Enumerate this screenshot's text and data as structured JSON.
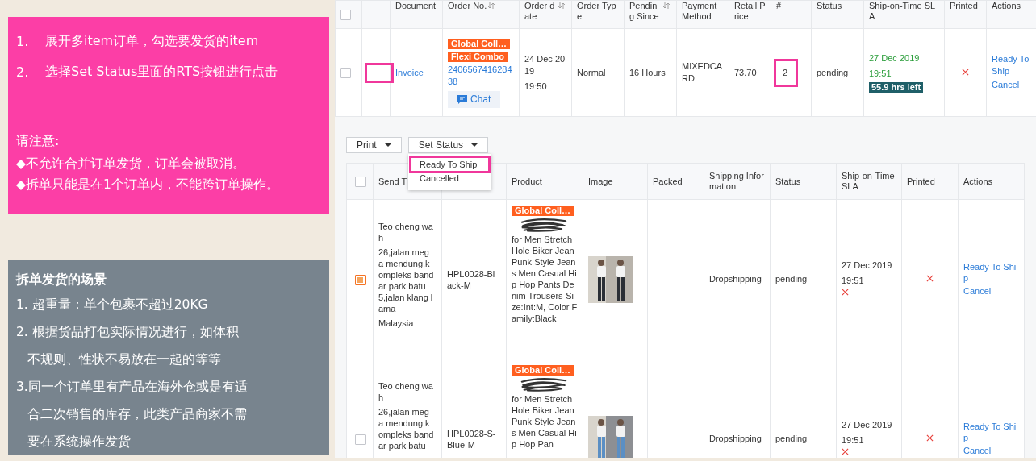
{
  "instructions": {
    "steps": [
      {
        "number": "1.",
        "text": "展开多item订单，勾选要发货的item"
      },
      {
        "number": "2.",
        "text": "选择Set Status里面的RTS按钮进行点击"
      }
    ],
    "note_title": "请注意:",
    "notes": [
      "◆不允许合并订单发货，订单会被取消。",
      "◆拆单只能是在1个订单内，不能跨订单操作。"
    ]
  },
  "scenarios": {
    "title": "拆单发货的场景",
    "items": [
      {
        "lines": [
          "1. 超重量：单个包裹不超过20KG"
        ]
      },
      {
        "lines": [
          "2. 根据货品打包实际情况进行，如体积",
          "不规则、性状不易放在一起的等等"
        ]
      },
      {
        "lines": [
          "3.同一个订单里有产品在海外仓或是有适",
          "合二次销售的库存，此类产品商家不需",
          "要在系统操作发货"
        ]
      }
    ]
  },
  "order_table": {
    "select_all": {
      "checked": false
    },
    "columns": [
      {
        "label": "Document",
        "sortable": false
      },
      {
        "label": "Order No.",
        "sortable": true
      },
      {
        "label": "Order date",
        "sortable": true
      },
      {
        "label": "Order Type",
        "sortable": false
      },
      {
        "label": "Pending Since",
        "sortable": true
      },
      {
        "label": "Payment Method",
        "sortable": false
      },
      {
        "label": "Retail Price",
        "sortable": false
      },
      {
        "label": "#",
        "sortable": false
      },
      {
        "label": "Status",
        "sortable": false
      },
      {
        "label": "Ship-on-Time SLA",
        "sortable": false
      },
      {
        "label": "Printed",
        "sortable": false
      },
      {
        "label": "Actions",
        "sortable": false
      }
    ],
    "rows": [
      {
        "checked": false,
        "expand_symbol": "—",
        "expand_highlighted": true,
        "document": "Invoice",
        "tags": [
          "Global Coll…",
          "Flexi Combo"
        ],
        "order_no": "240656741628438",
        "chat": "Chat",
        "order_date": "24 Dec 2019",
        "order_time": "19:50",
        "order_type": "Normal",
        "pending_since": "16 Hours",
        "payment_method": "MIXEDCARD",
        "retail_price": "73.70",
        "quantity": "2",
        "quantity_highlighted": true,
        "status": "pending",
        "sla_date": "27 Dec 2019",
        "sla_time": "19:51",
        "sla_left": "55.9 hrs left",
        "printed": false,
        "actions": [
          "Ready To Ship",
          "Cancel"
        ]
      }
    ]
  },
  "toolbar": {
    "buttons": [
      "Print",
      "Set Status"
    ],
    "menu": [
      {
        "label": "Ready To Ship",
        "highlighted": true
      },
      {
        "label": "Cancelled",
        "highlighted": false
      }
    ]
  },
  "items_table": {
    "select_all": {
      "checked": false
    },
    "columns": [
      {
        "label": "Send T"
      },
      {
        "label": "Product"
      },
      {
        "label": "Image"
      },
      {
        "label": "Packed"
      },
      {
        "label": "Shipping Information"
      },
      {
        "label": "Status"
      },
      {
        "label": "Ship-on-Time SLA"
      },
      {
        "label": "Printed"
      },
      {
        "label": "Actions"
      }
    ],
    "rows": [
      {
        "checked": true,
        "recipient": "Teo cheng wah",
        "address": "26,jalan mega mendung,kompleks bandar park batu 5,jalan klang lama",
        "country": "Malaysia",
        "sku": "HPL0028-Black-M",
        "tag": "Global Coll…",
        "product": "for Men Stretch Hole Biker Jean Punk Style Jeans Men Casual Hip Hop Pants Denim Trousers-Size:Int:M, Color Family:Black",
        "image": {
          "kind": "picture"
        },
        "shipping": "Dropshipping",
        "status": "pending",
        "sla_date": "27 Dec 2019",
        "sla_time": "19:51",
        "sla_missed": true,
        "printed": false,
        "actions": [
          "Ready To Ship",
          "Cancel"
        ]
      },
      {
        "checked": false,
        "recipient": "Teo cheng wah",
        "address": "26,jalan mega mendung,kompleks bandar park batu",
        "sku": "HPL0028-S-Blue-M",
        "tag": "Global Coll…",
        "product": "for Men Stretch Hole Biker Jean Punk Style Jeans Men Casual Hip Hop Pan",
        "image": {
          "kind": "picture"
        },
        "shipping": "Dropshipping",
        "status": "pending",
        "sla_date": "27 Dec 2019",
        "sla_time": "19:51",
        "sla_missed": true,
        "printed": false,
        "actions": [
          "Ready To Ship",
          "Cancel"
        ]
      }
    ]
  }
}
